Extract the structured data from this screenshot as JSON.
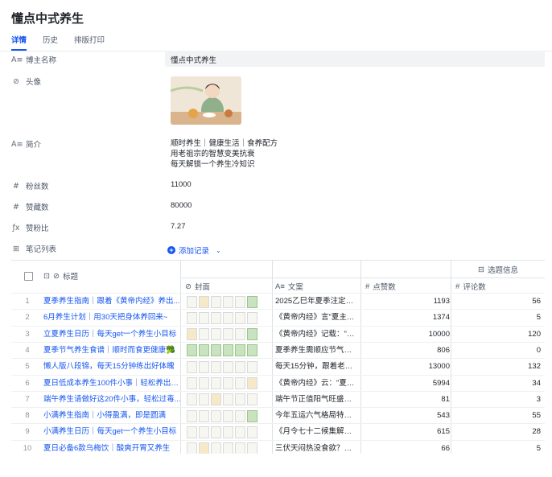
{
  "page": {
    "title": "懂点中式养生"
  },
  "tabs": [
    {
      "label": "详情"
    },
    {
      "label": "历史"
    },
    {
      "label": "排版打印"
    }
  ],
  "fields": {
    "blogger_name": {
      "label": "博主名称",
      "value": "懂点中式养生",
      "icon": "text-icon"
    },
    "avatar": {
      "label": "头像",
      "icon": "attachment-icon"
    },
    "bio": {
      "label": "简介",
      "icon": "text-icon",
      "lines": [
        "顺时养生｜健康生活｜食养配方",
        "用老祖宗的智慧变美抗衰",
        "每天解锁一个养生冷知识"
      ]
    },
    "followers": {
      "label": "粉丝数",
      "value": "11000",
      "icon": "number-icon"
    },
    "likes": {
      "label": "赞藏数",
      "value": "80000",
      "icon": "number-icon"
    },
    "ratio": {
      "label": "赞粉比",
      "value": "7.27",
      "icon": "formula-icon"
    },
    "notes": {
      "label": "笔记列表",
      "icon": "linked-record-icon",
      "add_label": "添加记录"
    }
  },
  "table": {
    "group_header": "选题信息",
    "headers": {
      "title": "标题",
      "cover": "封面",
      "text": "文案",
      "likes": "点赞数",
      "comments": "评论数"
    },
    "rows": [
      {
        "idx": "1",
        "title": "夏季养生指南｜跟着《黄帝内经》养出...",
        "text": "2025乙巳年夏季注定是...",
        "likes": "1193",
        "comments": "56"
      },
      {
        "idx": "2",
        "title": "6月养生计划｜用30天把身体养回来~",
        "text": "《黄帝内经》言\"夏主长...",
        "likes": "1374",
        "comments": "5"
      },
      {
        "idx": "3",
        "title": "立夏养生日历｜每天get一个养生小目标",
        "text": "《黄帝内经》记载：\"春...",
        "likes": "10000",
        "comments": "120"
      },
      {
        "idx": "4",
        "title": "夏季节气养生食谱｜顺时而食更健康🥦",
        "text": "夏季养生需顺应节气特...",
        "likes": "806",
        "comments": "0"
      },
      {
        "idx": "5",
        "title": "懒人版八段锦，每天15分钟练出好体魄",
        "text": "每天15分钟，跟着老祖...",
        "likes": "13000",
        "comments": "132"
      },
      {
        "idx": "6",
        "title": "夏日低成本养生100件小事｜轻松养出好...",
        "text": "《黄帝内经》云：\"夏三...",
        "likes": "5994",
        "comments": "34"
      },
      {
        "idx": "7",
        "title": "端午养生请做好这20件小事，轻松过毒...",
        "text": "端午节正值阳气旺盛、...",
        "likes": "81",
        "comments": "3"
      },
      {
        "idx": "8",
        "title": "小满养生指南｜小得盈满，即是圆满",
        "text": "今年五运六气格局特殊...",
        "likes": "543",
        "comments": "55"
      },
      {
        "idx": "9",
        "title": "小满养生日历｜每天get一个养生小目标",
        "text": "《月令七十二候集解》...",
        "likes": "615",
        "comments": "28"
      },
      {
        "idx": "10",
        "title": "夏日必备6款乌梅饮｜酸爽开胃又养生",
        "text": "三伏天闷热没食欲？这...",
        "likes": "66",
        "comments": "5"
      }
    ]
  }
}
